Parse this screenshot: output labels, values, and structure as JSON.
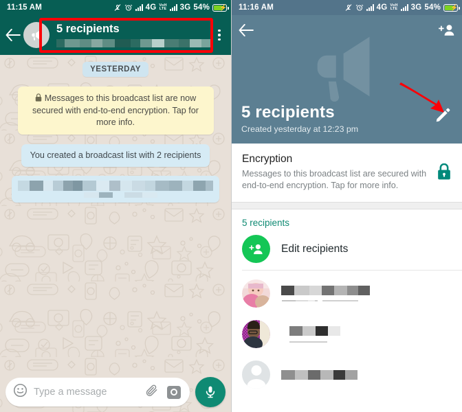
{
  "colors": {
    "whatsapp_header_green": "#075e54",
    "accent_green": "#0f8a73",
    "bright_green": "#14c656",
    "info_slate": "#5c7f92",
    "annotation_red": "#fb0007",
    "chat_background": "#e8e0d8",
    "incoming_bubble_blue": "#d6ebf5",
    "system_bubble_yellow": "#fdf6cd",
    "lock_teal": "#00897b"
  },
  "left_panel": {
    "status_bar": {
      "time": "11:15 AM",
      "icons": [
        "bell-muted-icon",
        "alarm-clock-icon",
        "signal-bars-icon",
        "volte-icon",
        "signal-bars-icon",
        "battery-charging-icon"
      ],
      "network_1": "4G",
      "volte_top": "VoH",
      "volte_bottom": "LTE",
      "network_2": "3G",
      "battery_percent": "54%"
    },
    "header": {
      "back_icon": "back-arrow-icon",
      "avatar_icon": "megaphone-icon",
      "title": "5 recipients",
      "subtitle_redacted": true,
      "menu_icon": "overflow-menu-icon"
    },
    "annotation": {
      "type": "red-rectangle-highlight",
      "target": "broadcast list title and recipients"
    },
    "chat": {
      "day_divider": "YESTERDAY",
      "encryption_notice": "Messages to this broadcast list are now secured with end-to-end encryption. Tap for more info.",
      "encryption_icon": "lock-icon",
      "system_message": "You created a broadcast list with 2 recipients",
      "redacted_message": true
    },
    "composer": {
      "emoji_icon": "emoji-smiley-icon",
      "placeholder": "Type a message",
      "attach_icon": "paperclip-icon",
      "camera_icon": "camera-icon",
      "mic_icon": "microphone-icon"
    }
  },
  "right_panel": {
    "status_bar": {
      "time": "11:16 AM",
      "network_1": "4G",
      "volte_top": "VoH",
      "volte_bottom": "LTE",
      "network_2": "3G",
      "battery_percent": "54%"
    },
    "hero": {
      "back_icon": "back-arrow-icon",
      "add_participant_icon": "add-person-icon",
      "background_icon": "megaphone-icon",
      "title": "5 recipients",
      "subtitle": "Created yesterday at 12:23 pm",
      "edit_icon": "pencil-edit-icon",
      "annotation": "red-arrow-pointing-to-edit-icon"
    },
    "encryption": {
      "title": "Encryption",
      "description": "Messages to this broadcast list are secured with end-to-end encryption. Tap for more info.",
      "lock_icon": "lock-icon"
    },
    "recipients": {
      "section_label": "5 recipients",
      "edit_row": {
        "icon": "add-person-icon",
        "label": "Edit recipients"
      },
      "contacts": [
        {
          "avatar": "photo-avatar-baby",
          "name_redacted": true,
          "status_redacted": true
        },
        {
          "avatar": "photo-avatar-person",
          "name_redacted": true,
          "status_redacted": true
        },
        {
          "avatar": "default-person-avatar",
          "name_redacted": true,
          "status_redacted": false
        }
      ]
    }
  }
}
